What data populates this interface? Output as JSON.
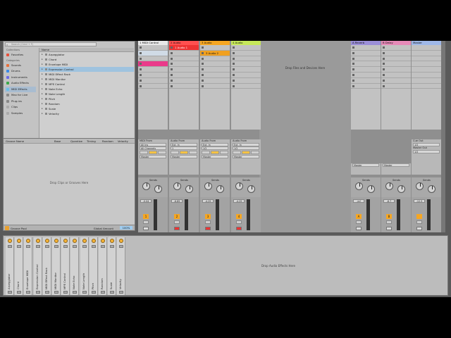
{
  "browser": {
    "search_placeholder": "Search (Cmd + F)",
    "collections_label": "Collections",
    "favorites": "Favorites",
    "categories_label": "Categories",
    "categories": [
      {
        "label": "Sounds",
        "color": "#e8703a"
      },
      {
        "label": "Drums",
        "color": "#3a8ae8"
      },
      {
        "label": "Instruments",
        "color": "#6a6ae8"
      },
      {
        "label": "Audio Effects",
        "color": "#3aa84a"
      },
      {
        "label": "MIDI Effects",
        "color": "#6ac0e8"
      },
      {
        "label": "Max for Live",
        "color": "#888"
      },
      {
        "label": "Plug-ins",
        "color": "#888"
      },
      {
        "label": "Clips",
        "color": "#aaa"
      },
      {
        "label": "Samples",
        "color": "#aaa"
      }
    ],
    "name_header": "Name",
    "items": [
      "Arpeggiator",
      "Chord",
      "Envelope MIDI",
      "Expression Control",
      "MIDI Effect Rack",
      "MIDI Monitor",
      "MPE Control",
      "Note Echo",
      "Note Length",
      "Pitch",
      "Random",
      "Scale",
      "Velocity"
    ]
  },
  "groove": {
    "columns": [
      "Groove Name",
      "Base",
      "Quantize",
      "Timing",
      "Random",
      "Velocity"
    ],
    "drop": "Drop Clips or Grooves Here",
    "footer": "Groove Pool",
    "global_amount_label": "Global Amount",
    "global_amount": "100%"
  },
  "tracks": [
    {
      "name": "1 MIDI Control",
      "color": "#e8e8e8",
      "from_label": "MIDI From",
      "from": "All Ins",
      "ch": "All Channels",
      "to": "Master",
      "vol": "-0.04",
      "num": "1"
    },
    {
      "name": "2 Audio",
      "color": "#ff5050",
      "from_label": "Audio From",
      "from": "Ext. In",
      "ch": "1",
      "to": "Master",
      "vol": "-6.89",
      "num": "2",
      "clip": "1 Audio 1"
    },
    {
      "name": "3 Audio",
      "color": "#f5a623",
      "from_label": "Audio From",
      "from": "Ext. In",
      "ch": "1/2",
      "to": "Master",
      "vol": "-4.29",
      "num": "3",
      "clip": "3 Audio 2"
    },
    {
      "name": "4 Audio",
      "color": "#c6e85a",
      "from_label": "Audio From",
      "from": "Ext. In",
      "ch": "1/2",
      "to": "Master",
      "vol": "-4.29",
      "num": "4"
    }
  ],
  "session_drop": "Drop Files and Devices Here",
  "returns": [
    {
      "name": "A Reverb",
      "color": "#9b8fd8",
      "to": "Master",
      "vol": "-inf",
      "letter": "A"
    },
    {
      "name": "B Delay",
      "color": "#e68ab8",
      "to": "Master",
      "vol": "-8.7",
      "letter": "B"
    }
  ],
  "master": {
    "name": "Master",
    "color": "#9fb8e8",
    "cue_label": "Cue Out",
    "cue": "1/2",
    "out_label": "Master Out",
    "out": "1/2",
    "vol": "-12.5"
  },
  "sends_label": "Sends",
  "devices": [
    "Arpeggiator",
    "Chord",
    "Envelope MIDI",
    "Expression Control",
    "MIDI Effect Rack",
    "MIDI Monitor",
    "MPE Control",
    "Note Echo",
    "Note Length",
    "Pitch",
    "Random",
    "Scale",
    "Velocity"
  ],
  "chain_drop": "Drop Audio Effects Here"
}
